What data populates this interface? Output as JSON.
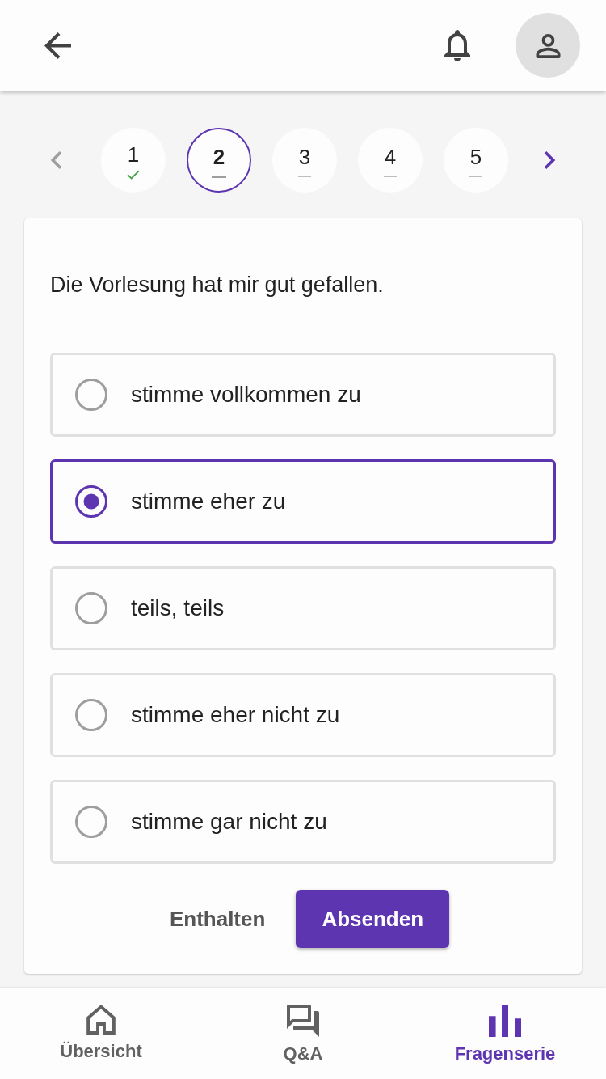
{
  "pager": {
    "previous_enabled": false,
    "next_enabled": true
  },
  "steps": [
    {
      "number": "1",
      "answered": true,
      "selected": false
    },
    {
      "number": "2",
      "answered": false,
      "selected": true
    },
    {
      "number": "3",
      "answered": false,
      "selected": false
    },
    {
      "number": "4",
      "answered": false,
      "selected": false
    },
    {
      "number": "5",
      "answered": false,
      "selected": false
    }
  ],
  "question": {
    "text": "Die Vorlesung hat mir gut gefallen.",
    "options": [
      {
        "label": "stimme vollkommen zu",
        "selected": false
      },
      {
        "label": "stimme eher zu",
        "selected": true
      },
      {
        "label": "teils, teils",
        "selected": false
      },
      {
        "label": "stimme eher nicht zu",
        "selected": false
      },
      {
        "label": "stimme gar nicht zu",
        "selected": false
      }
    ]
  },
  "actions": [
    {
      "label": "Enthalten",
      "kind": "text"
    },
    {
      "label": "Absenden",
      "kind": "primary"
    }
  ],
  "bottom_nav": [
    {
      "label": "Übersicht",
      "selected": false
    },
    {
      "label": "Q&A",
      "selected": false
    },
    {
      "label": "Fragenserie",
      "selected": true
    }
  ]
}
